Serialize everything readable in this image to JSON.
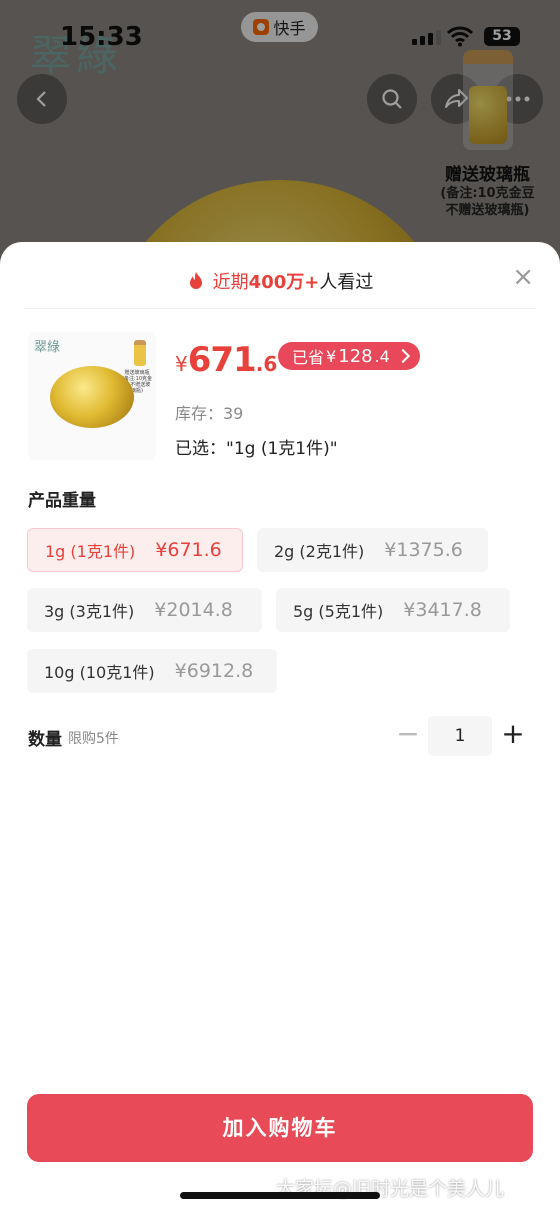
{
  "status_bar": {
    "time": "15:33",
    "app_name": "快手",
    "battery": "53"
  },
  "background": {
    "brand_text": "翠綠",
    "gift_title": "赠送玻璃瓶",
    "gift_note_line1": "(备注:10克金豆",
    "gift_note_line2": "不赠送玻璃瓶)"
  },
  "sheet": {
    "views_prefix": "近期",
    "views_count": "400万+",
    "views_suffix": "人看过",
    "close_label": "×"
  },
  "product": {
    "thumb_brand": "翠綠",
    "thumb_note": "赠送玻璃瓶 (备注:10克金豆 不赠送玻璃瓶)",
    "currency": "¥",
    "price_int": "671",
    "price_dec": ".6",
    "saved_label": "已省",
    "saved_currency": "¥",
    "saved_int": "128",
    "saved_dec": ".4",
    "stock": "库存：39",
    "selected": "已选：\"1g (1克1件)\""
  },
  "spec": {
    "title": "产品重量",
    "options": [
      {
        "label": "1g (1克1件)",
        "price": "¥671.6",
        "selected": true
      },
      {
        "label": "2g (2克1件)",
        "price": "¥1375.6",
        "selected": false
      },
      {
        "label": "3g (3克1件)",
        "price": "¥2014.8",
        "selected": false
      },
      {
        "label": "5g (5克1件)",
        "price": "¥3417.8",
        "selected": false
      },
      {
        "label": "10g (10克1件)",
        "price": "¥6912.8",
        "selected": false
      }
    ]
  },
  "quantity": {
    "label": "数量",
    "limit": "限购5件",
    "value": "1",
    "minus": "−",
    "plus": "+"
  },
  "cart_button": "加入购物车",
  "watermark": "大家坛@旧时光是个美人儿",
  "colors": {
    "accent": "#e8413b",
    "button": "#e84a57",
    "saved_badge": "#e8485a"
  }
}
